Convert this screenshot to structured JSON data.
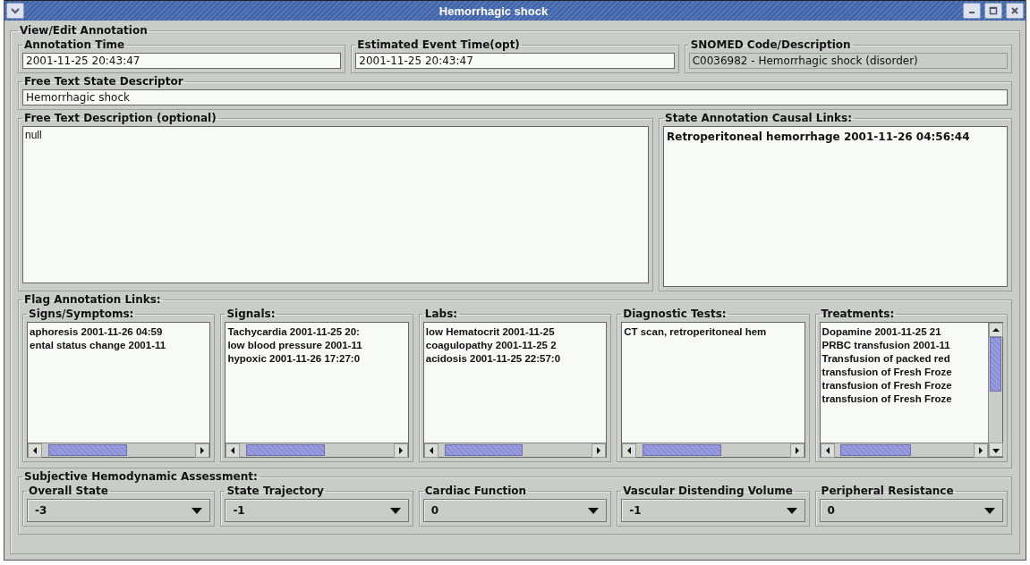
{
  "window": {
    "title": "Hemorrhagic shock"
  },
  "group_title": "View/Edit Annotation",
  "top_fields": [
    {
      "label": "Annotation Time",
      "value": "2001-11-25 20:43:47",
      "disabled": false
    },
    {
      "label": "Estimated Event Time(opt)",
      "value": "2001-11-25 20:43:47",
      "disabled": false
    },
    {
      "label": "SNOMED Code/Description",
      "value": "C0036982 - Hemorrhagic shock (disorder)",
      "disabled": true
    }
  ],
  "descriptor": {
    "label": "Free Text State Descriptor",
    "value": "Hemorrhagic shock"
  },
  "description": {
    "label": "Free Text Description (optional)",
    "value": "null"
  },
  "causal_links": {
    "label": "State Annotation Causal Links:",
    "items": [
      "Retroperitoneal hemorrhage 2001-11-26 04:56:44"
    ]
  },
  "flag_links": {
    "title": "Flag Annotation Links:",
    "lists": [
      {
        "label": "Signs/Symptoms:",
        "items": [
          "aphoresis 2001-11-26 04:59",
          "ental status change 2001-11"
        ]
      },
      {
        "label": "Signals:",
        "items": [
          "Tachycardia 2001-11-25 20:",
          "low blood pressure 2001-11",
          "hypoxic 2001-11-26 17:27:0"
        ]
      },
      {
        "label": "Labs:",
        "items": [
          "low Hematocrit 2001-11-25",
          "coagulopathy 2001-11-25 2",
          "acidosis 2001-11-25 22:57:0"
        ]
      },
      {
        "label": "Diagnostic Tests:",
        "items": [
          "CT scan, retroperitoneal hem"
        ]
      },
      {
        "label": "Treatments:",
        "items": [
          "Dopamine 2001-11-25 21",
          "PRBC transfusion 2001-11",
          "Transfusion of packed red",
          "transfusion of Fresh Froze",
          "transfusion of Fresh Froze",
          "transfusion of Fresh Froze"
        ]
      }
    ]
  },
  "assessment": {
    "title": "Subjective Hemodynamic Assessment:",
    "selects": [
      {
        "label": "Overall State",
        "value": "-3"
      },
      {
        "label": "State Trajectory",
        "value": "-1"
      },
      {
        "label": "Cardiac Function",
        "value": "0"
      },
      {
        "label": "Vascular Distending Volume",
        "value": "-1"
      },
      {
        "label": "Peripheral Resistance",
        "value": "0"
      }
    ]
  }
}
